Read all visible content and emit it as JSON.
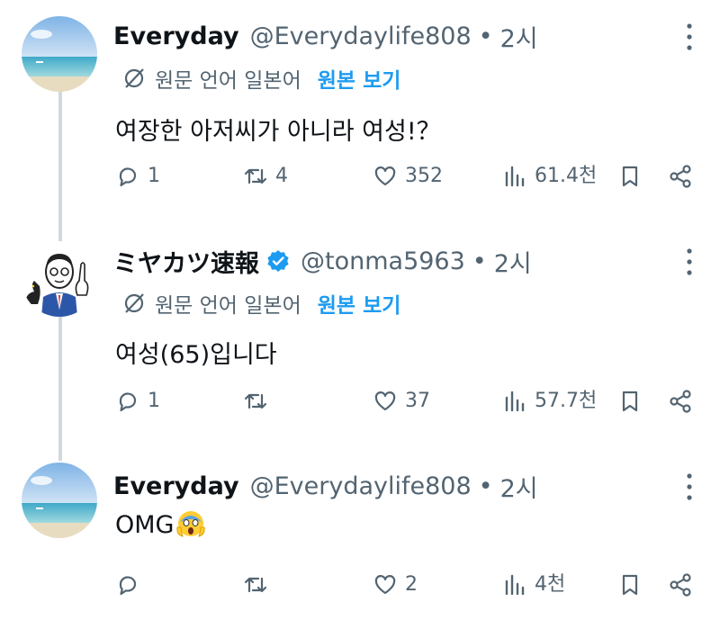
{
  "tweets": [
    {
      "name": "Everyday",
      "handle": "@Everydaylife808",
      "dot": "•",
      "time": "2시",
      "translate_label": "원문 언어 일본어",
      "translate_link": "원본 보기",
      "text": "여장한 아저씨가 아니라 여성!？",
      "replies": "1",
      "retweets": "4",
      "likes": "352",
      "views": "61.4천"
    },
    {
      "name": "ミヤカツ速報",
      "handle": "@tonma5963",
      "dot": "•",
      "time": "2시",
      "translate_label": "원문 언어 일본어",
      "translate_link": "원본 보기",
      "text": "여성(65)입니다",
      "replies": "1",
      "retweets": "",
      "likes": "37",
      "views": "57.7천"
    },
    {
      "name": "Everyday",
      "handle": "@Everydaylife808",
      "dot": "•",
      "time": "2시",
      "text": "OMG",
      "replies": "",
      "retweets": "",
      "likes": "2",
      "views": "4천"
    }
  ],
  "icons": {
    "reply": "reply-icon",
    "retweet": "retweet-icon",
    "like": "heart-icon",
    "views": "views-icon",
    "bookmark": "bookmark-icon",
    "share": "share-icon",
    "more": "more-icon",
    "translate": "translate-icon",
    "verified": "verified-badge-icon",
    "emoji": "screaming-face-emoji"
  },
  "colors": {
    "text": "#0f1419",
    "secondary": "#536471",
    "link": "#1d9bf0",
    "thread_line": "#cfd9de"
  }
}
